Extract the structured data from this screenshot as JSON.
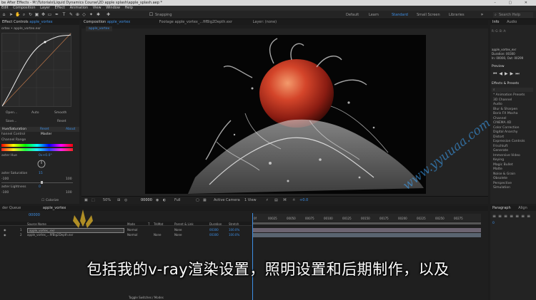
{
  "app": {
    "title": "be After Effects - M:\\Tutorials\\Liquid Dynamics Course\\2D apple splash\\apple_splash.aep *"
  },
  "menu": [
    "Edit",
    "Composition",
    "Layer",
    "Effect",
    "Animation",
    "View",
    "Window",
    "Help"
  ],
  "toolbar": {
    "snapping_label": "Snapping",
    "workspaces": [
      "Default",
      "Learn",
      "Standard",
      "Small Screen",
      "Libraries"
    ],
    "active_workspace": "Standard",
    "search_placeholder": "Search Help"
  },
  "effect_controls": {
    "tab_label": "Effect Controls",
    "tab_layer": "apple_vortex",
    "subhead": "ortex • apple_vortex.exr",
    "curve_buttons": [
      "Open...",
      "Auto",
      "Smooth"
    ],
    "curve_buttons2": [
      "Save...",
      "Reset"
    ],
    "effect_name": "Hue/Saturation",
    "reset_label": "Reset",
    "about_label": "About",
    "channel_control_label": "hannel Control",
    "channel_control_value": "Master",
    "channel_range_label": "Channel Range",
    "master_hue_label": "aster Hue",
    "master_hue_value": "0x+0.0°",
    "master_saturation_label": "aster Saturation",
    "master_saturation_value": "15",
    "sat_min": "-100",
    "sat_max": "100",
    "master_lightness_label": "aster Lightness",
    "master_lightness_value": "0",
    "light_min": "-100",
    "light_max": "100",
    "colorize_label": "Colorize"
  },
  "viewer": {
    "tab_composition_label": "Composition",
    "tab_composition_name": "apple_vortex",
    "tab_footage_label": "Footage apple_vortex_...fifBig2Depth.exr",
    "tab_layer_label": "Layer: (none)",
    "comp_name_tab": "apple_vortex",
    "zoom": "50%",
    "timecode": "00000",
    "resolution": "Full",
    "camera": "Active Camera",
    "views": "1 View",
    "exposure": "+0.0"
  },
  "info_panel": {
    "tabs": [
      "Info",
      "Audio"
    ],
    "layer_name": "apple_vortex_exr",
    "duration": "Duration: 00300",
    "in_out": "In: 00000, Out: 00299"
  },
  "preview_panel": {
    "label": "Preview"
  },
  "effects_presets": {
    "label": "Effects & Presets",
    "search_placeholder": "⌕",
    "categories": [
      "* Animation Presets",
      "3D Channel",
      "Audio",
      "Blur & Sharpen",
      "Boris FX Mocha",
      "Channel",
      "CINEMA 4D",
      "Color Correction",
      "Digital Anarchy",
      "Distort",
      "Expression Controls",
      "Frischluft",
      "Generate",
      "Immersive Video",
      "Keying",
      "Magic Bullet",
      "Matte",
      "Noise & Grain",
      "Obsolete",
      "Perspective",
      "Simulation"
    ]
  },
  "paragraph_panel": {
    "tabs": [
      "Paragraph",
      "Align"
    ],
    "value": "0"
  },
  "timeline": {
    "render_queue_label": "der Queue",
    "comp_tab": "apple_vortex",
    "timecode": "00000",
    "columns": [
      "Source Name",
      "Mode",
      "T",
      "TrkMat",
      "Parent & Link",
      "Duration",
      "Stretch"
    ],
    "layers": [
      {
        "num": "1",
        "name": "apple_vortex_.exr",
        "mode": "Normal",
        "trkmat": "",
        "parent": "None",
        "duration": "00300",
        "stretch": "100.0%"
      },
      {
        "num": "2",
        "name": "apple_vortex_...fifBig2Depth.exr",
        "mode": "Normal",
        "trkmat": "None",
        "parent": "None",
        "duration": "00300",
        "stretch": "100.0%"
      }
    ],
    "ruler_ticks": [
      "0f",
      "00025",
      "00050",
      "00075",
      "00100",
      "00125",
      "00150",
      "00175",
      "00200",
      "00225",
      "00250",
      "00275"
    ],
    "toggle_label": "Toggle Switches / Modes"
  },
  "subtitle": {
    "text": "包括我的v-ray渲染设置，照明设置和后期制作，以及"
  },
  "watermark": {
    "text": "www.yyuuaa.com"
  }
}
